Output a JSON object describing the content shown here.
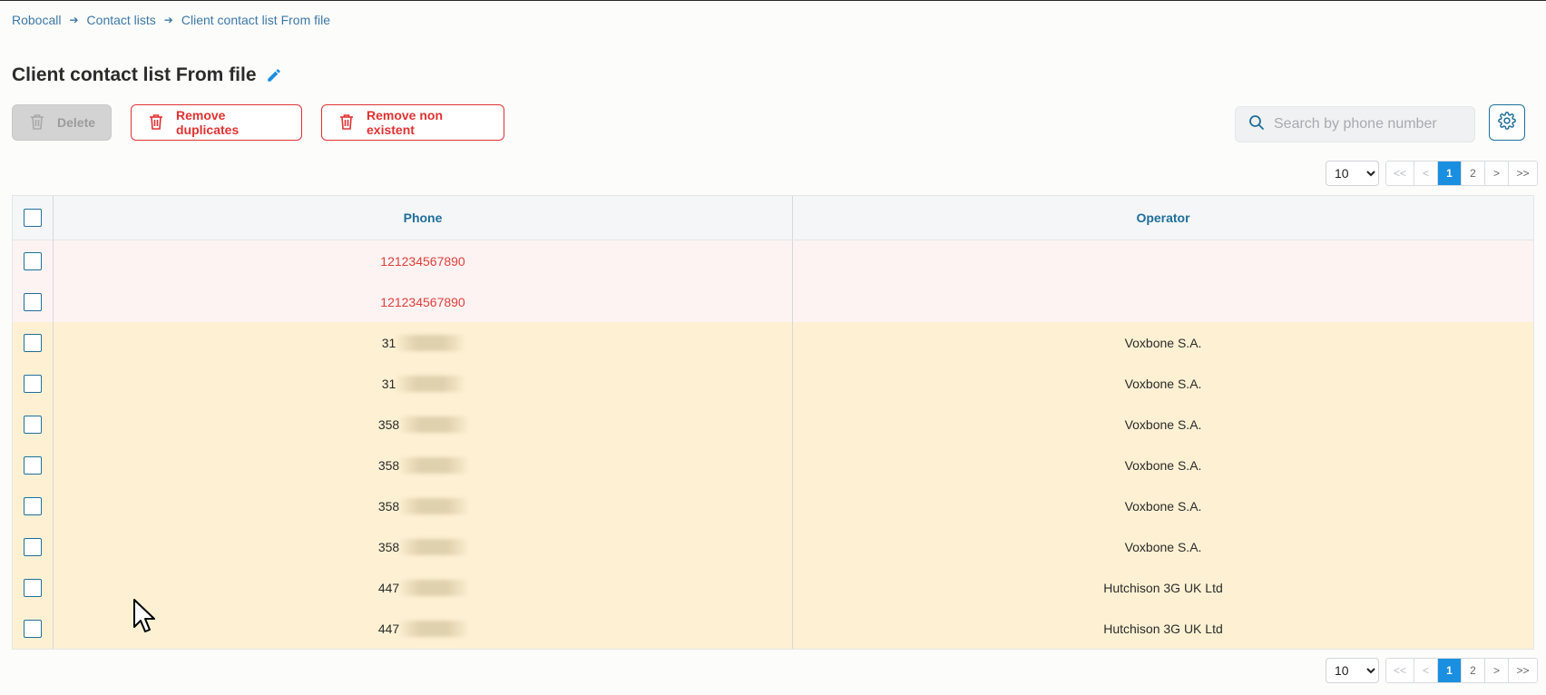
{
  "breadcrumb": [
    "Robocall",
    "Contact lists",
    "Client contact list From file"
  ],
  "page": {
    "title": "Client contact list From file"
  },
  "toolbar": {
    "delete_label": "Delete",
    "remove_duplicates_label": "Remove duplicates",
    "remove_non_existent_label": "Remove non existent"
  },
  "search": {
    "placeholder": "Search by phone number",
    "value": ""
  },
  "pagination": {
    "page_size": "10",
    "page_size_options": [
      "10"
    ],
    "first": "<<",
    "prev": "<",
    "pages": [
      "1",
      "2"
    ],
    "current": "1",
    "next": ">",
    "last": ">>"
  },
  "table": {
    "columns": {
      "phone": "Phone",
      "operator": "Operator"
    },
    "rows": [
      {
        "phone": "121234567890",
        "operator": "",
        "status": "error"
      },
      {
        "phone": "121234567890",
        "operator": "",
        "status": "error"
      },
      {
        "phone": "31",
        "operator": "Voxbone S.A.",
        "status": "warn",
        "redacted": true
      },
      {
        "phone": "31",
        "operator": "Voxbone S.A.",
        "status": "warn",
        "redacted": true
      },
      {
        "phone": "358",
        "operator": "Voxbone S.A.",
        "status": "warn",
        "redacted": true
      },
      {
        "phone": "358",
        "operator": "Voxbone S.A.",
        "status": "warn",
        "redacted": true
      },
      {
        "phone": "358",
        "operator": "Voxbone S.A.",
        "status": "warn",
        "redacted": true
      },
      {
        "phone": "358",
        "operator": "Voxbone S.A.",
        "status": "warn",
        "redacted": true
      },
      {
        "phone": "447",
        "operator": "Hutchison 3G UK Ltd",
        "status": "warn",
        "redacted": true
      },
      {
        "phone": "447",
        "operator": "Hutchison 3G UK Ltd",
        "status": "warn",
        "redacted": true
      }
    ]
  },
  "colors": {
    "accent": "#1f6f9b",
    "danger": "#e03232",
    "error_row": "#fdf3f3",
    "warn_row": "#fef1d3",
    "active_page": "#1a8fe0"
  },
  "icons": [
    "arrow-right-icon",
    "pencil-icon",
    "trash-icon",
    "search-icon",
    "gear-icon",
    "mouse-cursor-icon"
  ]
}
